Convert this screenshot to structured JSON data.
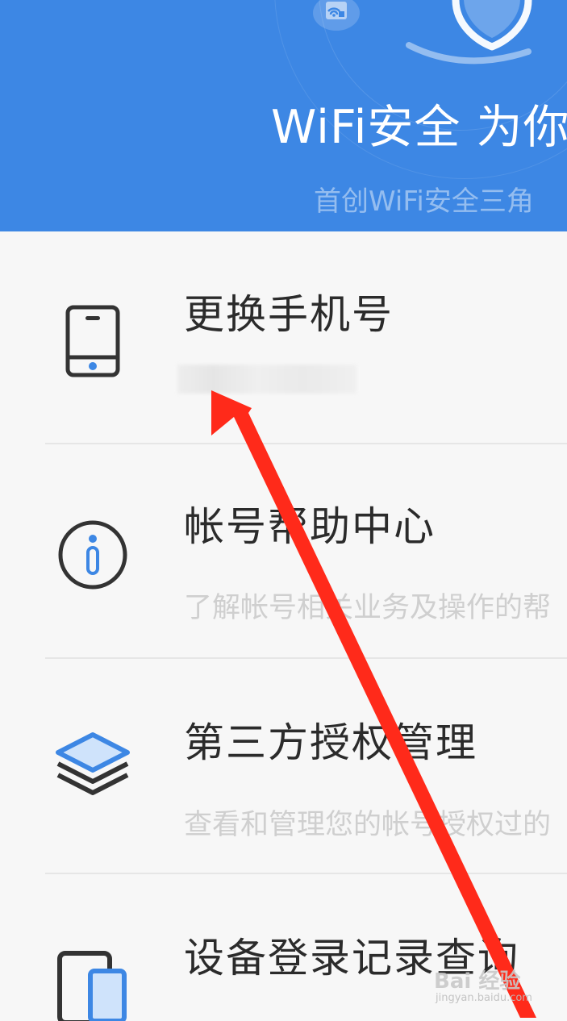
{
  "header": {
    "title": "WiFi安全 为你",
    "subtitle": "首创WiFi安全三角",
    "icons": [
      "wifi-icon",
      "shield-icon"
    ]
  },
  "items": [
    {
      "title": "更换手机号",
      "icon": "phone-icon"
    },
    {
      "title": "帐号帮助中心",
      "description": "了解帐号相关业务及操作的帮",
      "icon": "info-icon"
    },
    {
      "title": "第三方授权管理",
      "description": "查看和管理您的帐号授权过的",
      "icon": "layers-icon"
    },
    {
      "title": "设备登录记录查询",
      "icon": "devices-icon"
    }
  ],
  "colors": {
    "header_bg": "#3d87e4",
    "accent": "#3d87e4",
    "arrow": "#ff2a1a"
  },
  "watermark": {
    "main": "Bai 经验",
    "sub": "jingyan.baidu.com"
  }
}
